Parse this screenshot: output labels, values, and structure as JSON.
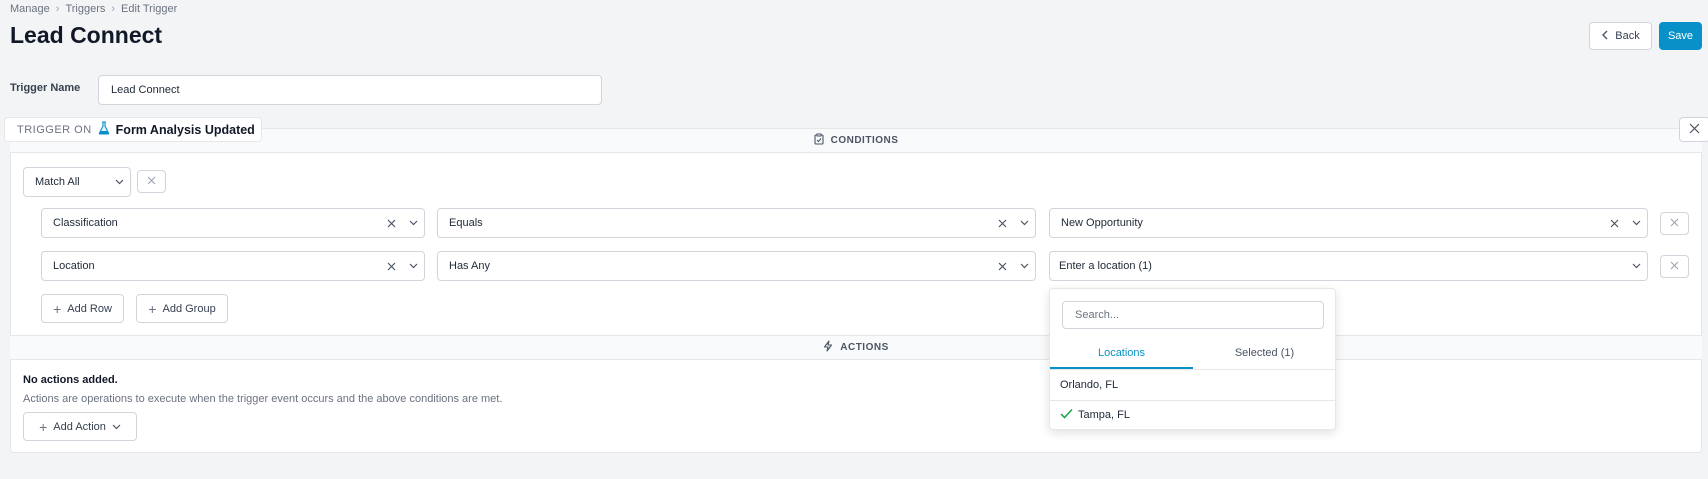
{
  "breadcrumb": {
    "items": [
      "Manage",
      "Triggers",
      "Edit Trigger"
    ]
  },
  "page": {
    "title": "Lead Connect"
  },
  "header": {
    "back_label": "Back",
    "save_label": "Save"
  },
  "trigger_name": {
    "label": "Trigger Name",
    "value": "Lead Connect"
  },
  "trigger_on": {
    "label": "TRIGGER ON",
    "event": "Form Analysis Updated"
  },
  "conditions": {
    "title": "CONDITIONS",
    "match": "Match All",
    "rows": [
      {
        "field": "Classification",
        "operator": "Equals",
        "value": "New Opportunity"
      },
      {
        "field": "Location",
        "operator": "Has Any",
        "value": "Enter a location (1)"
      }
    ],
    "add_row_label": "Add Row",
    "add_group_label": "Add Group"
  },
  "location_dropdown": {
    "search_placeholder": "Search...",
    "tabs": [
      "Locations",
      "Selected (1)"
    ],
    "options": [
      {
        "label": "Orlando, FL",
        "selected": false
      },
      {
        "label": "Tampa, FL",
        "selected": true
      }
    ]
  },
  "actions": {
    "title": "ACTIONS",
    "empty_title": "No actions added.",
    "empty_desc": "Actions are operations to execute when the trigger event occurs and the above conditions are met.",
    "add_label": "Add Action"
  },
  "colors": {
    "accent": "#0891c8",
    "check": "#16a34a"
  }
}
